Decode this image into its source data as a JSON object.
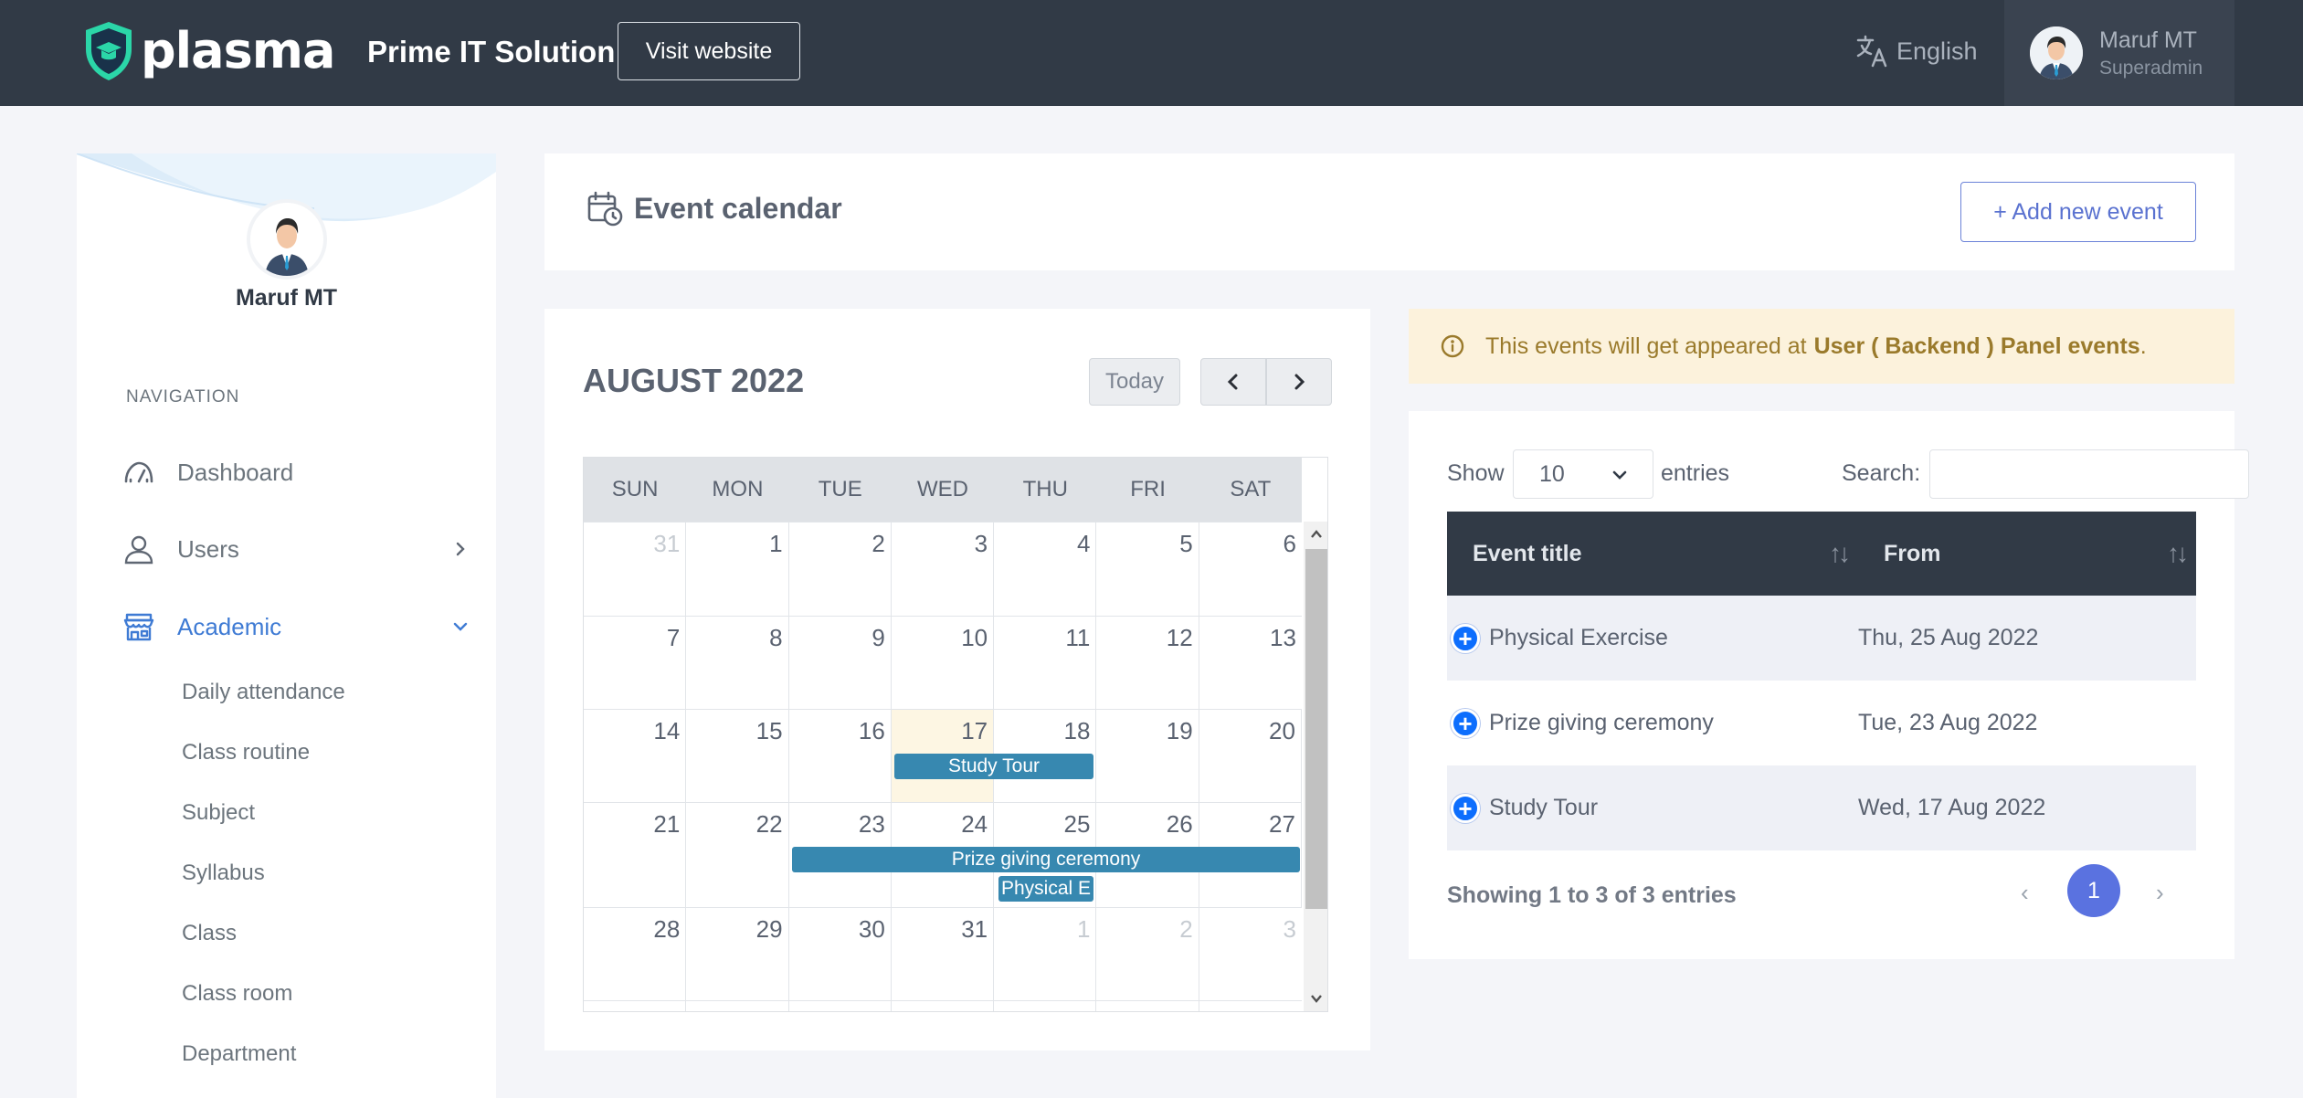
{
  "topbar": {
    "logo": "plasma",
    "school_name": "Prime IT Solution",
    "visit_website": "Visit website",
    "language": "English",
    "user_name": "Maruf MT",
    "user_role": "Superadmin"
  },
  "sidebar": {
    "user_name": "Maruf MT",
    "nav_title": "NAVIGATION",
    "items": [
      {
        "label": "Dashboard",
        "icon": "gauge-icon"
      },
      {
        "label": "Users",
        "icon": "user-icon"
      },
      {
        "label": "Academic",
        "icon": "store-icon"
      }
    ],
    "academic_sub": [
      "Daily attendance",
      "Class routine",
      "Subject",
      "Syllabus",
      "Class",
      "Class room",
      "Department"
    ]
  },
  "page": {
    "title": "Event calendar",
    "add_button": "+ Add new event"
  },
  "calendar": {
    "month": "AUGUST 2022",
    "today_label": "Today",
    "days_of_week": [
      "SUN",
      "MON",
      "TUE",
      "WED",
      "THU",
      "FRI",
      "SAT"
    ],
    "weeks": [
      [
        "31",
        "1",
        "2",
        "3",
        "4",
        "5",
        "6"
      ],
      [
        "7",
        "8",
        "9",
        "10",
        "11",
        "12",
        "13"
      ],
      [
        "14",
        "15",
        "16",
        "17",
        "18",
        "19",
        "20"
      ],
      [
        "21",
        "22",
        "23",
        "24",
        "25",
        "26",
        "27"
      ],
      [
        "28",
        "29",
        "30",
        "31",
        "1",
        "2",
        "3"
      ]
    ],
    "events": {
      "study_tour": "Study Tour",
      "prize": "Prize giving ceremony",
      "physical": "Physical E"
    }
  },
  "alert": {
    "text": "This events will get appeared at",
    "bold": "User ( Backend ) Panel events",
    "end": "."
  },
  "table": {
    "show": "Show",
    "page_size": "10",
    "entries": "entries",
    "search": "Search:",
    "search_value": "",
    "headers": [
      "Event title",
      "From"
    ],
    "rows": [
      {
        "title": "Physical Exercise",
        "from": "Thu, 25 Aug 2022"
      },
      {
        "title": "Prize giving ceremony",
        "from": "Tue, 23 Aug 2022"
      },
      {
        "title": "Study Tour",
        "from": "Wed, 17 Aug 2022"
      }
    ],
    "info": "Showing 1 to 3 of 3 entries",
    "prev": "‹",
    "next": "›",
    "current_page": "1"
  },
  "colors": {
    "topbar": "#313a46",
    "accent": "#5a72e0",
    "event": "#3788b0",
    "alert_bg": "#fcf2dc"
  }
}
